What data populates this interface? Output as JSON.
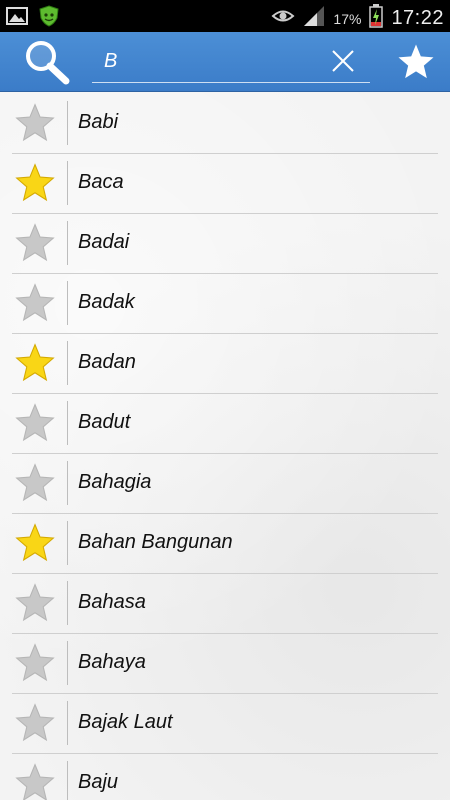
{
  "status_bar": {
    "battery_percent": "17%",
    "time": "17:22"
  },
  "search": {
    "query": "B"
  },
  "colors": {
    "star_on": "#f9d616",
    "star_off": "#c8c8c8",
    "actionbar": "#4386d0"
  },
  "words": [
    {
      "label": "Babi",
      "favorite": false
    },
    {
      "label": "Baca",
      "favorite": true
    },
    {
      "label": "Badai",
      "favorite": false
    },
    {
      "label": "Badak",
      "favorite": false
    },
    {
      "label": "Badan",
      "favorite": true
    },
    {
      "label": "Badut",
      "favorite": false
    },
    {
      "label": "Bahagia",
      "favorite": false
    },
    {
      "label": "Bahan Bangunan",
      "favorite": true
    },
    {
      "label": "Bahasa",
      "favorite": false
    },
    {
      "label": "Bahaya",
      "favorite": false
    },
    {
      "label": "Bajak Laut",
      "favorite": false
    },
    {
      "label": "Baju",
      "favorite": false
    }
  ]
}
